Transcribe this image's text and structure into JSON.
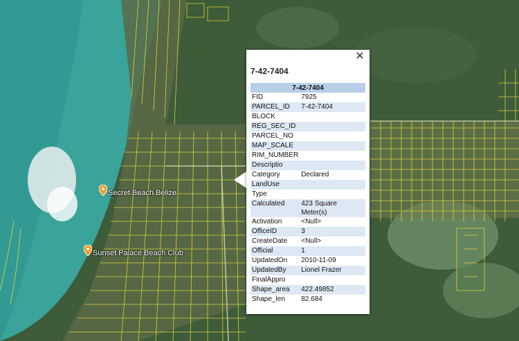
{
  "map": {
    "places": [
      {
        "name": "Secret Beach Belize"
      },
      {
        "name": "Sunset Palace Beach Club"
      }
    ]
  },
  "popup": {
    "title": "7-42-7404",
    "close_icon": "close-icon",
    "table_header": "7-42-7404",
    "rows": [
      {
        "key": "FID",
        "value": "7925"
      },
      {
        "key": "PARCEL_ID",
        "value": "7-42-7404"
      },
      {
        "key": "BLOCK",
        "value": ""
      },
      {
        "key": "REG_SEC_ID",
        "value": ""
      },
      {
        "key": "PARCEL_NO",
        "value": ""
      },
      {
        "key": "MAP_SCALE",
        "value": ""
      },
      {
        "key": "RIM_NUMBER",
        "value": ""
      },
      {
        "key": "Descriptio",
        "value": ""
      },
      {
        "key": "Category",
        "value": "Declared"
      },
      {
        "key": "LandUse",
        "value": ""
      },
      {
        "key": "Type",
        "value": ""
      },
      {
        "key": "Calculated",
        "value": "423 Square Meter(s)"
      },
      {
        "key": "Activation",
        "value": "<Null>"
      },
      {
        "key": "OfficeID",
        "value": "3"
      },
      {
        "key": "CreateDate",
        "value": "<Null>"
      },
      {
        "key": "Official",
        "value": "1"
      },
      {
        "key": "UpdatedOn",
        "value": "2010-11-09"
      },
      {
        "key": "UpdatedBy",
        "value": "Lionel Frazer"
      },
      {
        "key": "FinalAppro",
        "value": ""
      },
      {
        "key": "Shape_area",
        "value": "422.49852"
      },
      {
        "key": "Shape_len",
        "value": "82.684"
      }
    ]
  },
  "colors": {
    "sea": "#3aa39a",
    "land": "#3e5b3a",
    "parcel_line": "#e6e23a",
    "header_row": "#b8cfe8",
    "alt_row": "#dde8f4"
  }
}
